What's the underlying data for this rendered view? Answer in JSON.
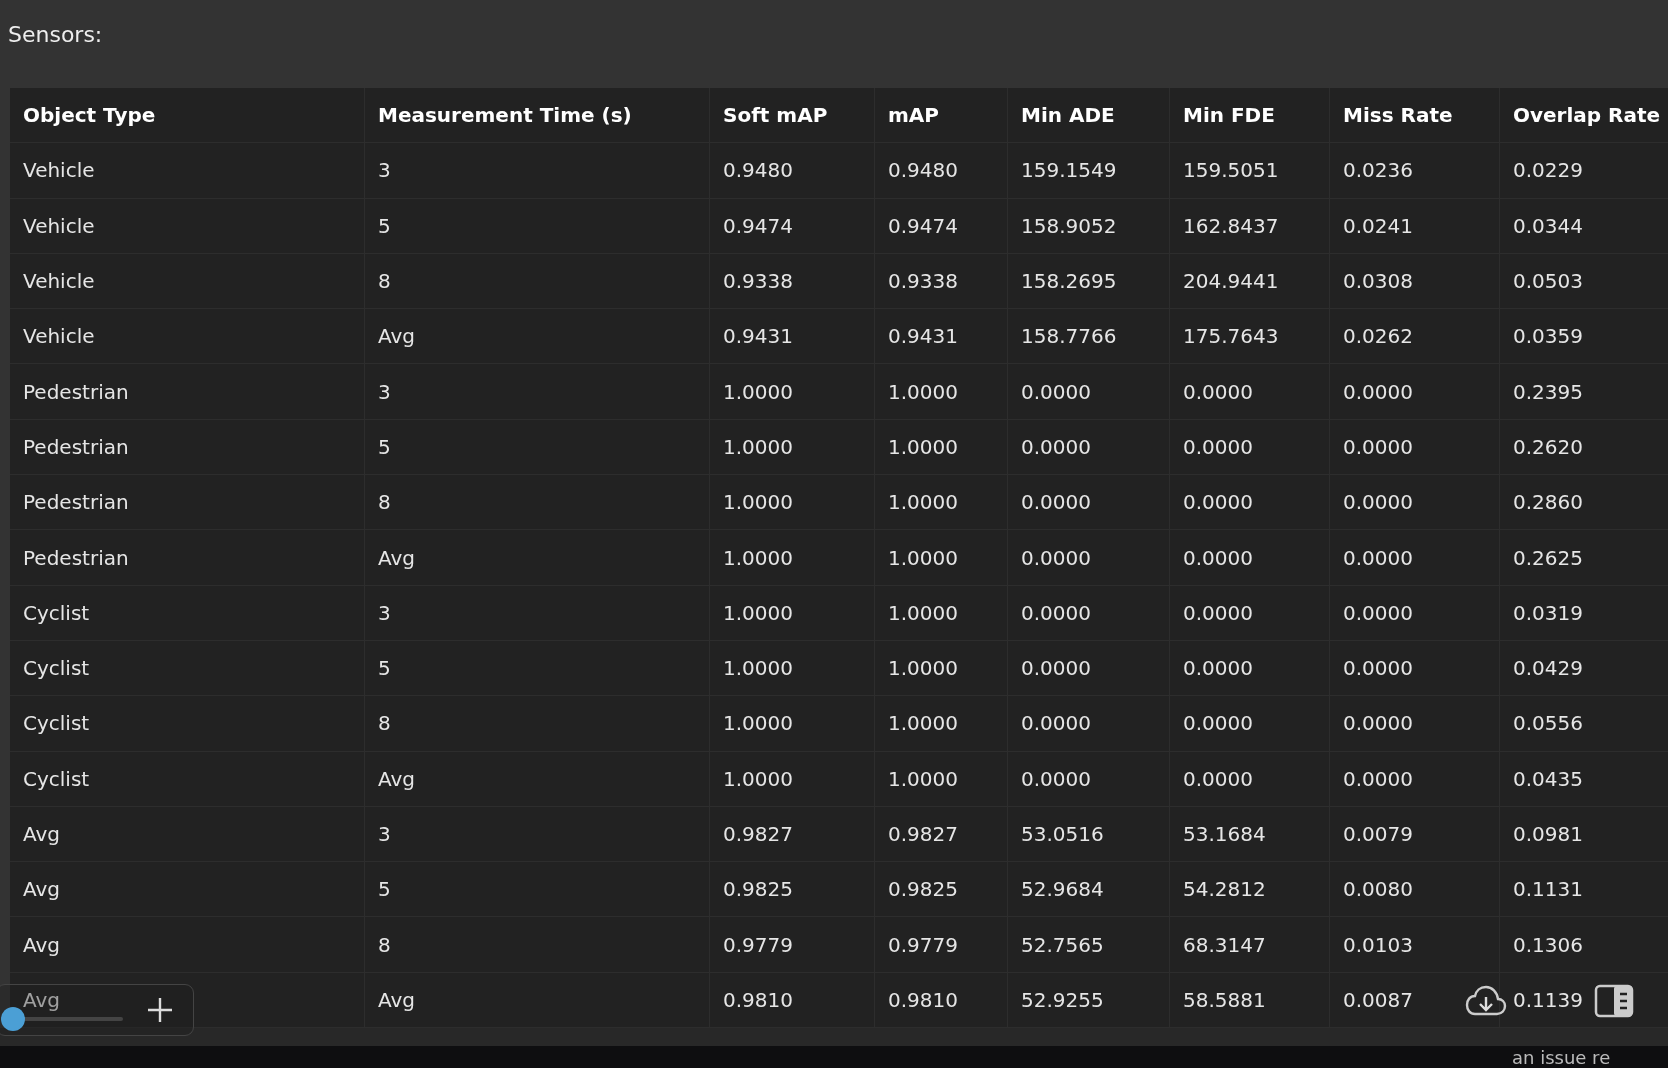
{
  "label": "Sensors:",
  "table": {
    "columns": [
      "Object Type",
      "Measurement Time (s)",
      "Soft mAP",
      "mAP",
      "Min ADE",
      "Min FDE",
      "Miss Rate",
      "Overlap Rate"
    ],
    "rows": [
      [
        "Vehicle",
        "3",
        "0.9480",
        "0.9480",
        "159.1549",
        "159.5051",
        "0.0236",
        "0.0229"
      ],
      [
        "Vehicle",
        "5",
        "0.9474",
        "0.9474",
        "158.9052",
        "162.8437",
        "0.0241",
        "0.0344"
      ],
      [
        "Vehicle",
        "8",
        "0.9338",
        "0.9338",
        "158.2695",
        "204.9441",
        "0.0308",
        "0.0503"
      ],
      [
        "Vehicle",
        "Avg",
        "0.9431",
        "0.9431",
        "158.7766",
        "175.7643",
        "0.0262",
        "0.0359"
      ],
      [
        "Pedestrian",
        "3",
        "1.0000",
        "1.0000",
        "0.0000",
        "0.0000",
        "0.0000",
        "0.2395"
      ],
      [
        "Pedestrian",
        "5",
        "1.0000",
        "1.0000",
        "0.0000",
        "0.0000",
        "0.0000",
        "0.2620"
      ],
      [
        "Pedestrian",
        "8",
        "1.0000",
        "1.0000",
        "0.0000",
        "0.0000",
        "0.0000",
        "0.2860"
      ],
      [
        "Pedestrian",
        "Avg",
        "1.0000",
        "1.0000",
        "0.0000",
        "0.0000",
        "0.0000",
        "0.2625"
      ],
      [
        "Cyclist",
        "3",
        "1.0000",
        "1.0000",
        "0.0000",
        "0.0000",
        "0.0000",
        "0.0319"
      ],
      [
        "Cyclist",
        "5",
        "1.0000",
        "1.0000",
        "0.0000",
        "0.0000",
        "0.0000",
        "0.0429"
      ],
      [
        "Cyclist",
        "8",
        "1.0000",
        "1.0000",
        "0.0000",
        "0.0000",
        "0.0000",
        "0.0556"
      ],
      [
        "Cyclist",
        "Avg",
        "1.0000",
        "1.0000",
        "0.0000",
        "0.0000",
        "0.0000",
        "0.0435"
      ],
      [
        "Avg",
        "3",
        "0.9827",
        "0.9827",
        "53.0516",
        "53.1684",
        "0.0079",
        "0.0981"
      ],
      [
        "Avg",
        "5",
        "0.9825",
        "0.9825",
        "52.9684",
        "54.2812",
        "0.0080",
        "0.1131"
      ],
      [
        "Avg",
        "8",
        "0.9779",
        "0.9779",
        "52.7565",
        "68.3147",
        "0.0103",
        "0.1306"
      ],
      [
        "Avg",
        "Avg",
        "0.9810",
        "0.9810",
        "52.9255",
        "58.5881",
        "0.0087",
        "0.1139"
      ]
    ]
  },
  "zoom_control": {
    "level": 0
  },
  "footer": {
    "text": "an issue re"
  }
}
